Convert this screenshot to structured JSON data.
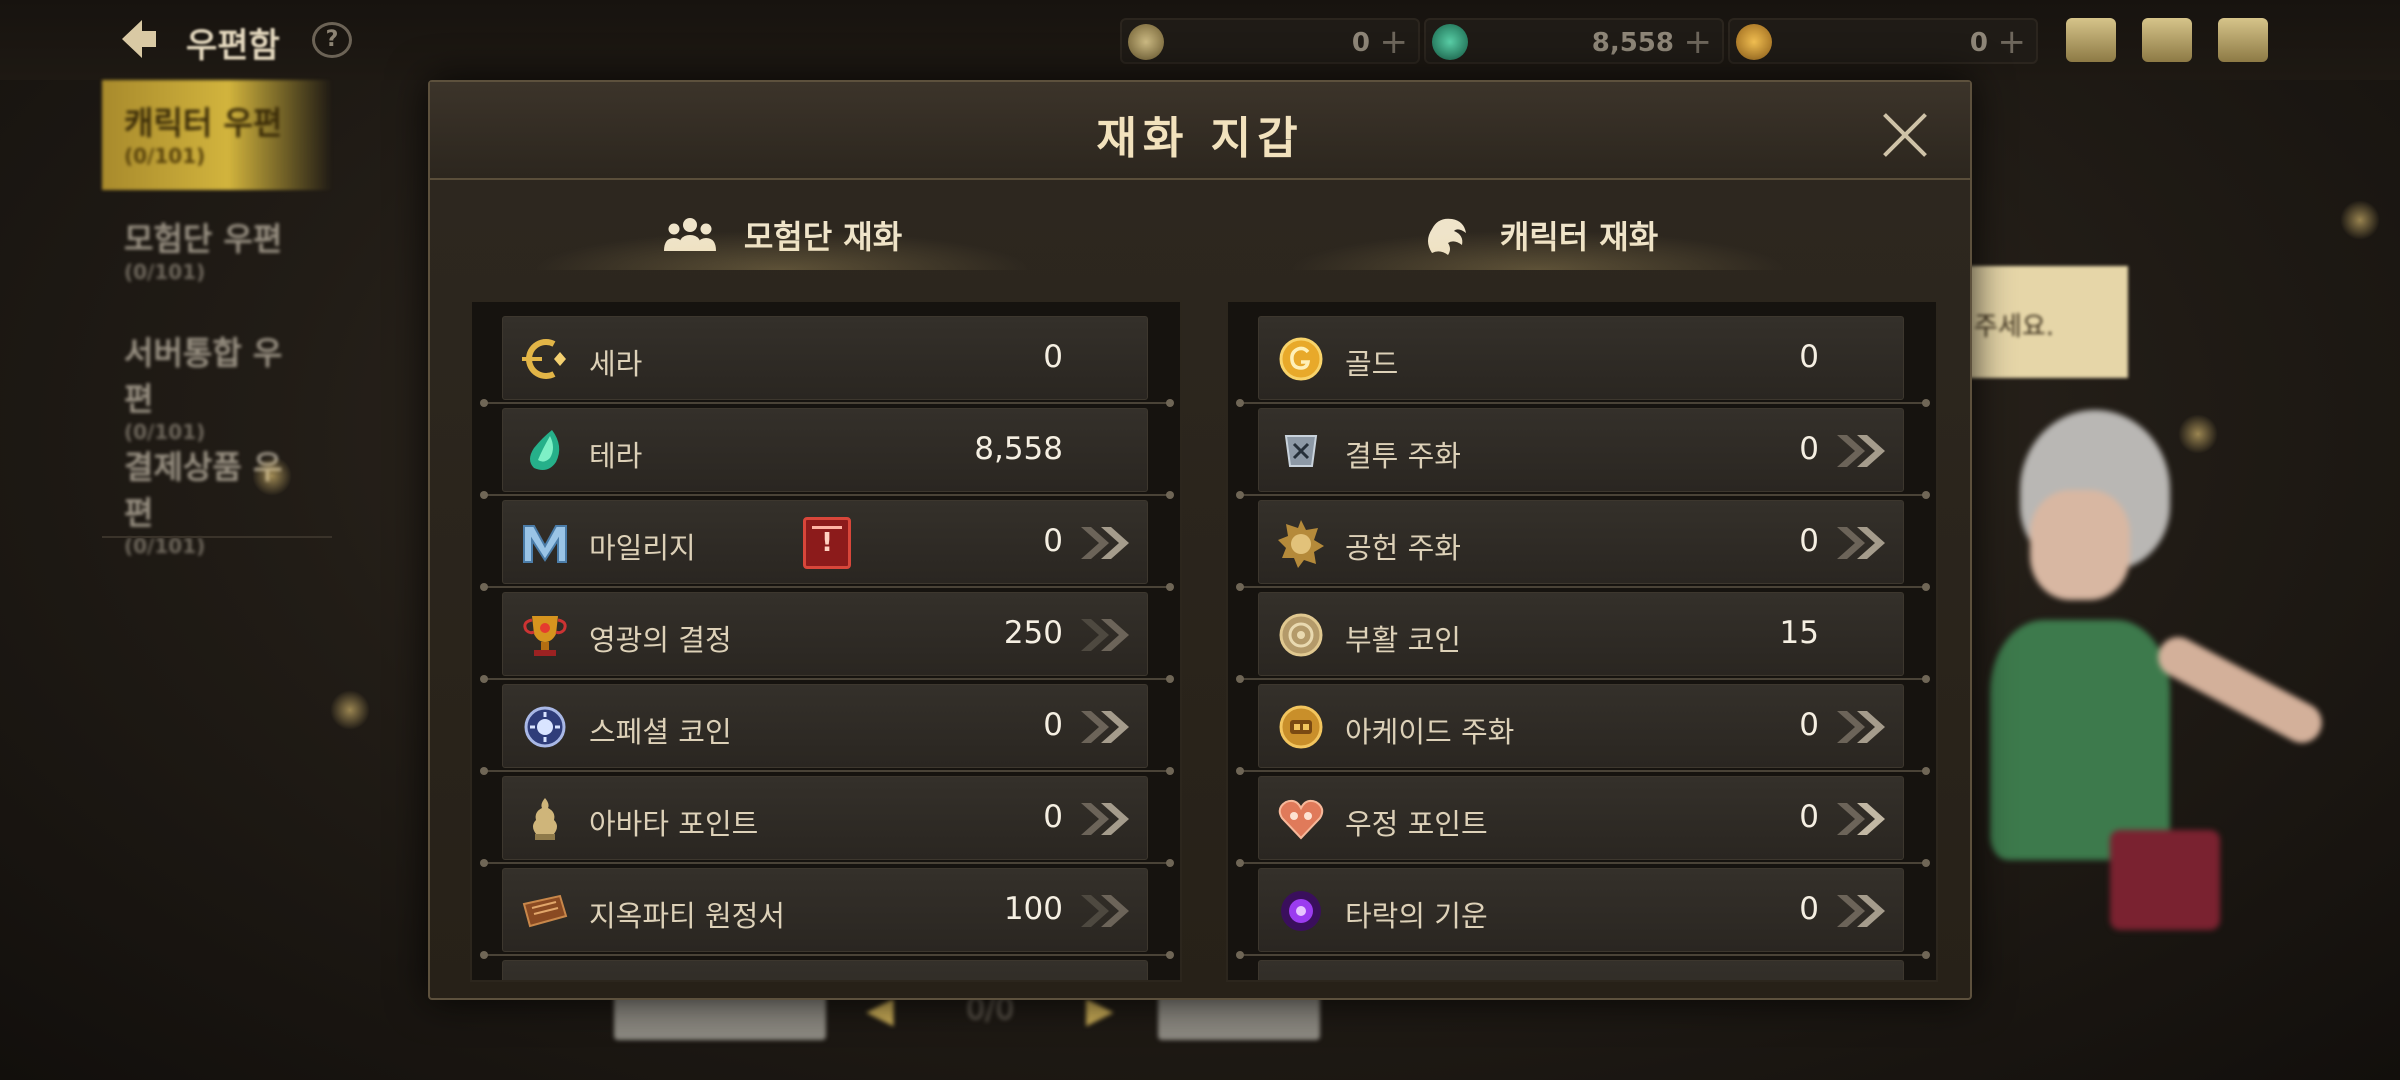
{
  "topbar": {
    "title": "우편함",
    "help": "?",
    "currencies": [
      {
        "icon": "cera-icon",
        "value": "0",
        "plus": "+"
      },
      {
        "icon": "tera-icon",
        "value": "8,558",
        "plus": "+"
      },
      {
        "icon": "gold-icon",
        "value": "0",
        "plus": "+"
      }
    ]
  },
  "sidebar": {
    "items": [
      {
        "label": "캐릭터 우편",
        "count": "(0/101)"
      },
      {
        "label": "모험단 우편",
        "count": "(0/101)"
      },
      {
        "label": "서버통합 우편",
        "count": "(0/101)"
      },
      {
        "label": "결제상품 우편",
        "count": "(0/101)"
      }
    ]
  },
  "background": {
    "note_text": "주세요.",
    "page_indicator": "0/0"
  },
  "modal": {
    "title": "재화 지갑",
    "left_section": {
      "title": "모험단 재화",
      "icon": "party-icon",
      "rows": [
        {
          "name": "세라",
          "value": "0",
          "icon": "cera-icon",
          "arrow": false
        },
        {
          "name": "테라",
          "value": "8,558",
          "icon": "tera-crystal-icon",
          "arrow": false
        },
        {
          "name": "마일리지",
          "value": "0",
          "icon": "mileage-icon",
          "arrow": true,
          "event_badge": true
        },
        {
          "name": "영광의 결정",
          "value": "250",
          "icon": "trophy-icon",
          "arrow": true
        },
        {
          "name": "스페셜 코인",
          "value": "0",
          "icon": "special-coin-icon",
          "arrow": true
        },
        {
          "name": "아바타 포인트",
          "value": "0",
          "icon": "avatar-point-icon",
          "arrow": true
        },
        {
          "name": "지옥파티 원정서",
          "value": "100",
          "icon": "hell-party-ticket-icon",
          "arrow": true
        }
      ]
    },
    "right_section": {
      "title": "캐릭터 재화",
      "icon": "character-icon",
      "rows": [
        {
          "name": "골드",
          "value": "0",
          "icon": "gold-coin-icon",
          "arrow": false
        },
        {
          "name": "결투 주화",
          "value": "0",
          "icon": "duel-coin-icon",
          "arrow": true
        },
        {
          "name": "공헌 주화",
          "value": "0",
          "icon": "contribution-coin-icon",
          "arrow": true
        },
        {
          "name": "부활 코인",
          "value": "15",
          "icon": "revive-coin-icon",
          "arrow": false
        },
        {
          "name": "아케이드 주화",
          "value": "0",
          "icon": "arcade-coin-icon",
          "arrow": true
        },
        {
          "name": "우정 포인트",
          "value": "0",
          "icon": "friendship-point-icon",
          "arrow": true
        },
        {
          "name": "타락의 기운",
          "value": "0",
          "icon": "corruption-energy-icon",
          "arrow": true
        }
      ]
    }
  },
  "colors": {
    "modal_bg": "#2e2820",
    "title_text": "#f2e2bd",
    "value_text": "#f5efe2",
    "label_text": "#ddd1b8",
    "accent_gold": "#d2b43d"
  }
}
